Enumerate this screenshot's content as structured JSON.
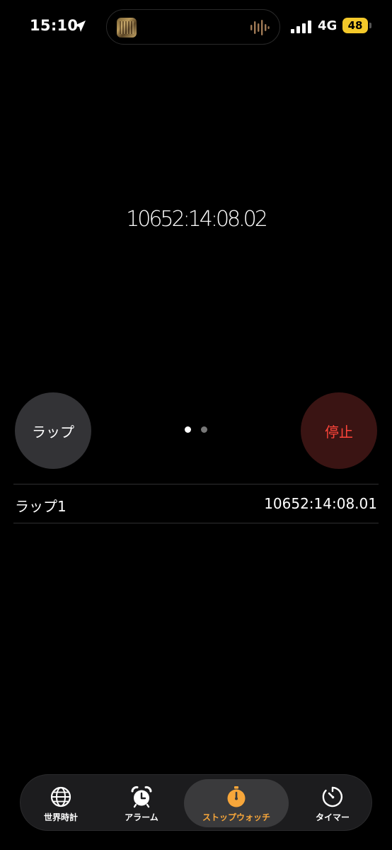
{
  "status_bar": {
    "time": "15:10",
    "network": "4G",
    "battery": "48"
  },
  "stopwatch": {
    "elapsed": "10652:14:08.02"
  },
  "controls": {
    "lap_label": "ラップ",
    "stop_label": "停止",
    "page_count": 2,
    "active_page": 1
  },
  "laps": [
    {
      "label": "ラップ1",
      "time": "10652:14:08.01"
    }
  ],
  "tabs": [
    {
      "id": "world-clock",
      "label": "世界時計",
      "icon": "globe-icon",
      "selected": false
    },
    {
      "id": "alarm",
      "label": "アラーム",
      "icon": "alarm-clock-icon",
      "selected": false
    },
    {
      "id": "stopwatch",
      "label": "ストップウォッチ",
      "icon": "stopwatch-icon",
      "selected": true
    },
    {
      "id": "timer",
      "label": "タイマー",
      "icon": "timer-icon",
      "selected": false
    }
  ],
  "colors": {
    "background": "#000000",
    "accent": "#f7a63a",
    "stop_text": "#ff453a",
    "stop_bg": "#3a1413",
    "lap_bg": "#333336",
    "battery": "#f4c92a"
  }
}
